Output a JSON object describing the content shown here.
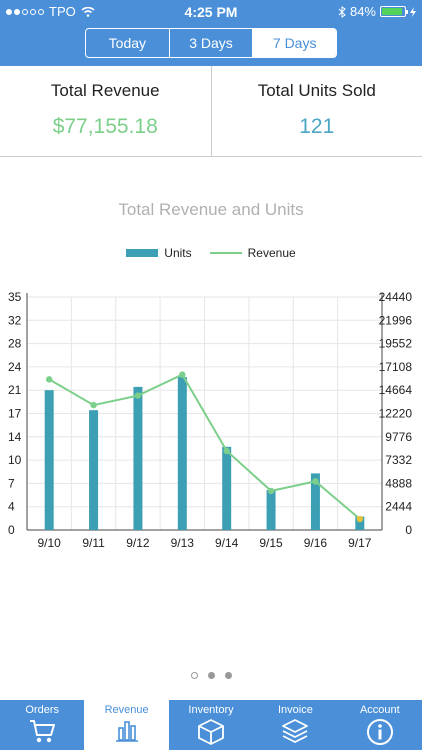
{
  "status": {
    "carrier": "TPO",
    "time": "4:25 PM",
    "battery": "84%"
  },
  "segments": [
    "Today",
    "3 Days",
    "7 Days"
  ],
  "stats": {
    "revenue_label": "Total Revenue",
    "revenue_value": "$77,155.18",
    "units_label": "Total Units Sold",
    "units_value": "121"
  },
  "chart_data": {
    "type": "bar",
    "title": "Total Revenue and Units",
    "categories": [
      "9/10",
      "9/11",
      "9/12",
      "9/13",
      "9/14",
      "9/15",
      "9/16",
      "9/17"
    ],
    "series": [
      {
        "name": "Units",
        "type": "bar",
        "axis": "left",
        "values": [
          21,
          18,
          21.5,
          23,
          12.5,
          6,
          8.5,
          2
        ]
      },
      {
        "name": "Revenue",
        "type": "line",
        "axis": "right",
        "values": [
          15800,
          13100,
          14100,
          16300,
          8300,
          4100,
          5100,
          1150
        ]
      }
    ],
    "left_axis": {
      "ticks": [
        "0",
        "4",
        "7",
        "10",
        "14",
        "17",
        "21",
        "24",
        "28",
        "32",
        "35"
      ],
      "max": 35
    },
    "right_axis": {
      "ticks": [
        "0",
        "2444",
        "4888",
        "7332",
        "9776",
        "12220",
        "14664",
        "17108",
        "19552",
        "21996",
        "24440"
      ],
      "max": 24440
    },
    "grid": true
  },
  "pager": {
    "current": 2,
    "total": 3
  },
  "tabs": [
    {
      "label": "Orders",
      "icon": "cart-icon"
    },
    {
      "label": "Revenue",
      "icon": "bar-chart-icon",
      "active": true
    },
    {
      "label": "Inventory",
      "icon": "box-icon"
    },
    {
      "label": "Invoice",
      "icon": "layers-icon"
    },
    {
      "label": "Account",
      "icon": "info-icon"
    }
  ],
  "colors": {
    "header": "#4a8fd8",
    "bar": "#3d9fb3",
    "line": "#7ccf8a",
    "revenue_text": "#7ccf8a",
    "units_text": "#4aa6c4"
  }
}
